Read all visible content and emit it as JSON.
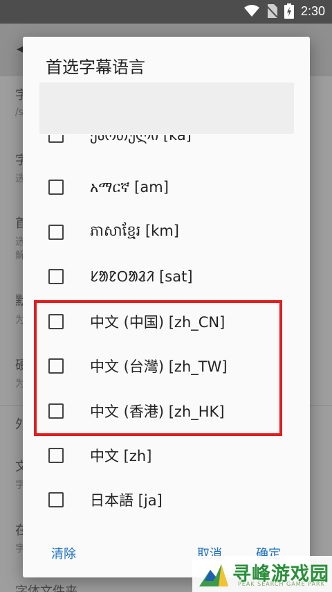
{
  "status_bar": {
    "time": "2:30"
  },
  "background": {
    "rows": [
      "字",
      "/s",
      "字",
      "选",
      "首",
      "选",
      "解",
      "默",
      "为",
      "硬",
      "为",
      "外",
      "文",
      "字",
      "在",
      "字",
      "字体文件夹"
    ]
  },
  "dialog": {
    "title": "首选字幕语言",
    "search_value": "",
    "languages": [
      {
        "label": "ქართული [ka]",
        "checked": false
      },
      {
        "label": "አማርኛ [am]",
        "checked": false
      },
      {
        "label": "ភាសាខ្មែរ [km]",
        "checked": false
      },
      {
        "label": "ᱥᱟᱱᱛᱟᱲᱤ [sat]",
        "checked": false
      },
      {
        "label": "中文 (中国) [zh_CN]",
        "checked": false
      },
      {
        "label": "中文 (台灣) [zh_TW]",
        "checked": false
      },
      {
        "label": "中文 (香港) [zh_HK]",
        "checked": false
      },
      {
        "label": "中文 [zh]",
        "checked": false
      },
      {
        "label": "日本語 [ja]",
        "checked": false
      }
    ],
    "actions": {
      "clear": "清除",
      "cancel": "取消",
      "ok": "确定"
    }
  },
  "watermark": {
    "text": "寻峰游戏园",
    "sub": "PEAK SEARCH GAME PARK"
  },
  "colors": {
    "accent": "#1f6fbf",
    "highlight": "#e11d1d",
    "watermark": "#2a8f3a"
  }
}
